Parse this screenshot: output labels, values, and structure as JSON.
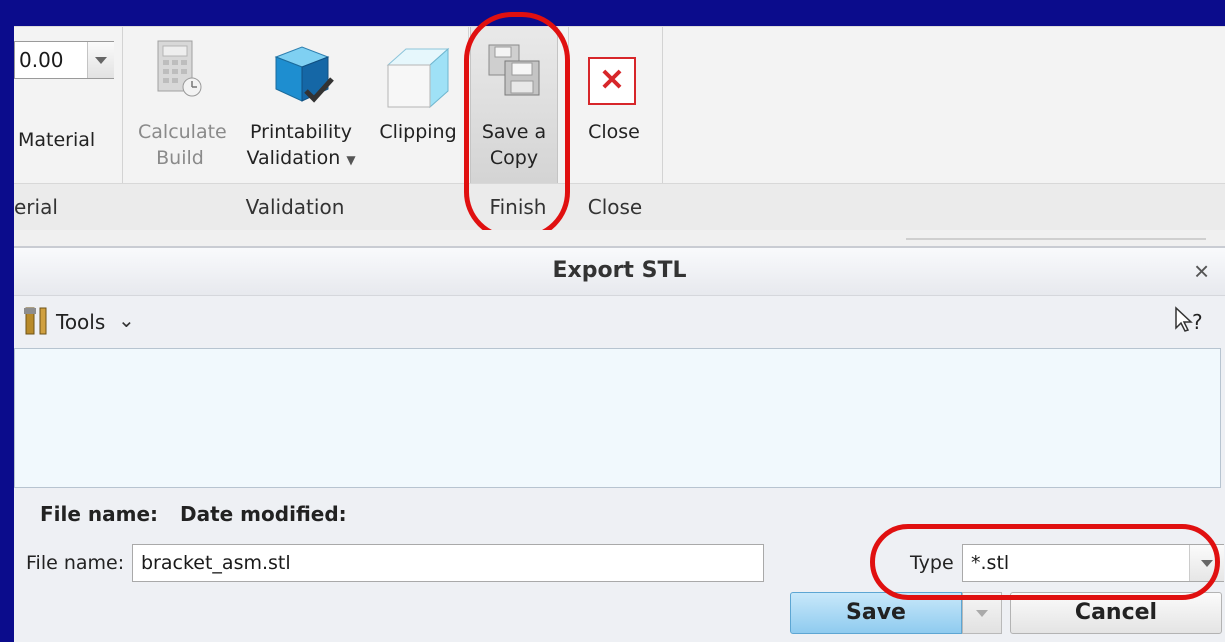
{
  "ribbon": {
    "material_combo_value": "0.00",
    "material_label": "Material",
    "material_group_label": "erial",
    "tools": {
      "calculate_build": [
        "Calculate",
        "Build"
      ],
      "printability_validation": [
        "Printability",
        "Validation"
      ],
      "clipping": "Clipping",
      "save_a_copy": [
        "Save a",
        "Copy"
      ],
      "close": "Close"
    },
    "groups": {
      "validation": "Validation",
      "finish": "Finish",
      "close": "Close"
    }
  },
  "dialog": {
    "title": "Export STL",
    "close_glyph": "×",
    "tools_label": "Tools",
    "help_glyph": "?",
    "columns": [
      "File name:",
      "Date modified:"
    ],
    "file_name_label": "File name:",
    "file_name_value": "bracket_asm.stl",
    "type_label": "Type",
    "type_value": "*.stl",
    "save_label": "Save",
    "cancel_label": "Cancel"
  },
  "colors": {
    "background": "#0b0c8c",
    "highlight_oval": "#e01010",
    "save_button": "#9fd3f0"
  }
}
